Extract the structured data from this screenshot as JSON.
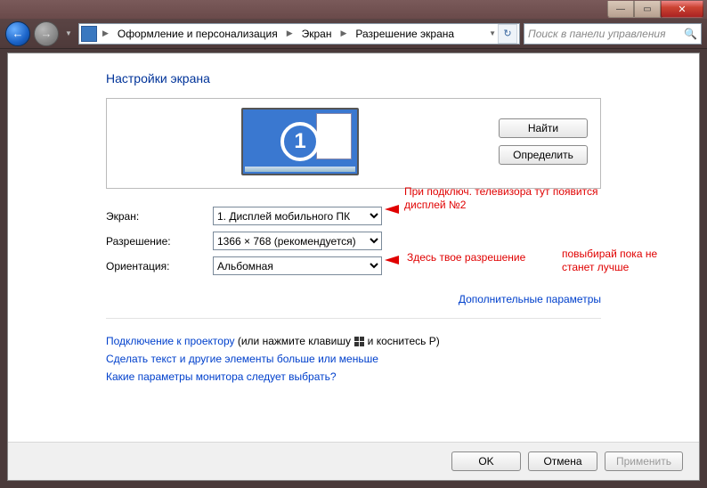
{
  "breadcrumbs": {
    "level1": "Оформление и персонализация",
    "level2": "Экран",
    "level3": "Разрешение экрана"
  },
  "search": {
    "placeholder": "Поиск в панели управления"
  },
  "page": {
    "title": "Настройки экрана",
    "monitor_number": "1",
    "buttons": {
      "find": "Найти",
      "detect": "Определить"
    }
  },
  "fields": {
    "display_label": "Экран:",
    "display_value": "1. Дисплей мобильного ПК",
    "resolution_label": "Разрешение:",
    "resolution_value": "1366 × 768 (рекомендуется)",
    "orientation_label": "Ориентация:",
    "orientation_value": "Альбомная"
  },
  "links": {
    "advanced": "Дополнительные параметры",
    "projector_link": "Подключение к проектору",
    "projector_text_a": " (или нажмите клавишу ",
    "projector_text_b": " и коснитесь P)",
    "text_size": "Сделать текст и другие элементы больше или меньше",
    "which_monitor": "Какие параметры монитора следует выбрать?"
  },
  "footer": {
    "ok": "OK",
    "cancel": "Отмена",
    "apply": "Применить"
  },
  "annotations": {
    "a1": "При подключ. телевизора тут появится дисплей №2",
    "a2": "Здесь твое разрешение",
    "a3": "повыбирай пока не станет лучше"
  }
}
